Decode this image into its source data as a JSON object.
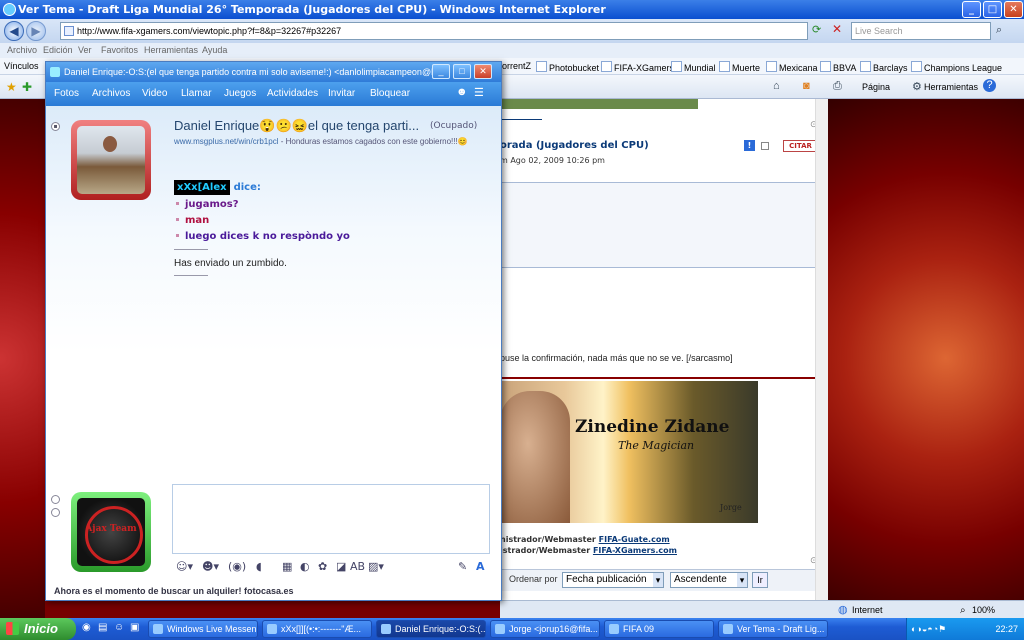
{
  "ie": {
    "title": "Ver Tema - Draft Liga Mundial 26° Temporada (Jugadores del CPU) - Windows Internet Explorer",
    "address": "http://www.fifa-xgamers.com/viewtopic.php?f=8&p=32267#p32267",
    "search_placeholder": "Live Search",
    "menu": [
      "Archivo",
      "Edición",
      "Ver",
      "Favoritos",
      "Herramientas",
      "Ayuda"
    ],
    "links_label": "Vínculos",
    "links": [
      "orrentZ",
      "Photobucket",
      "FIFA-XGamers",
      "Mundial",
      "Muerte",
      "Mexicana",
      "BBVA",
      "Barclays",
      "Champions League"
    ],
    "cmd": {
      "page": "Página",
      "tools": "Herramientas"
    }
  },
  "forum": {
    "post_title": "orada (Jugadores del CPU)",
    "post_date": "m Ago 02, 2009 10:26 pm",
    "citar": "CITAR",
    "sarcasmo": "puse la confirmación, nada más que no se ve. [/sarcasmo]",
    "banner": {
      "name": "Zinedine Zidane",
      "subtitle": "The Magician",
      "signature": "Jorge"
    },
    "sig_lines": [
      {
        "prefix": "nistrador/Webmaster ",
        "link": "FIFA-Guate.com"
      },
      {
        "prefix": "istrador/Webmaster ",
        "link": "FIFA-XGamers.com"
      }
    ],
    "order_label": "Ordenar por",
    "order_field": "Fecha publicación",
    "order_dir": "Ascendente",
    "go_button": "Ir"
  },
  "status": {
    "zone": "Internet",
    "zoom": "100%"
  },
  "msn": {
    "title": "Daniel Enrique:-O:S:(el que tenga partido contra mi solo aviseme!:) <danlolimpiacampeon@ho...",
    "menu": [
      "Fotos",
      "Archivos",
      "Video",
      "Llamar",
      "Juegos",
      "Actividades",
      "Invitar",
      "Bloquear"
    ],
    "contact_name": "Daniel Enrique😲😕😖el que tenga parti...",
    "contact_status": "(Ocupado)",
    "contact_url": "www.msgplus.net/win/crb1pcl",
    "contact_msg": " - Honduras estamos cagados con este gobierno!!!😊",
    "chat": {
      "sender": "xXx[Alex",
      "dice": "dice:",
      "lines": [
        {
          "text": "jugamos?",
          "color": "#6a1a8a"
        },
        {
          "text": "man",
          "color": "#b01040"
        },
        {
          "text": "luego dices k no respòndo yo",
          "color": "#4a1a9a"
        }
      ],
      "nudge": "Has enviado un zumbido."
    },
    "avatar_bottom_text": "Ajax Team",
    "ad": "Ahora es el momento de buscar un alquiler! fotocasa.es"
  },
  "taskbar": {
    "start": "Inicio",
    "tasks": [
      {
        "label": "Windows Live Messen..."
      },
      {
        "label": "xXx[]][(•:•:-------\"Æ..."
      },
      {
        "label": "Daniel Enrique:-O:S:(..."
      },
      {
        "label": "Jorge <jorup16@fifa..."
      },
      {
        "label": "FIFA 09"
      },
      {
        "label": "Ver Tema - Draft Lig..."
      }
    ],
    "clock": "22:27"
  }
}
